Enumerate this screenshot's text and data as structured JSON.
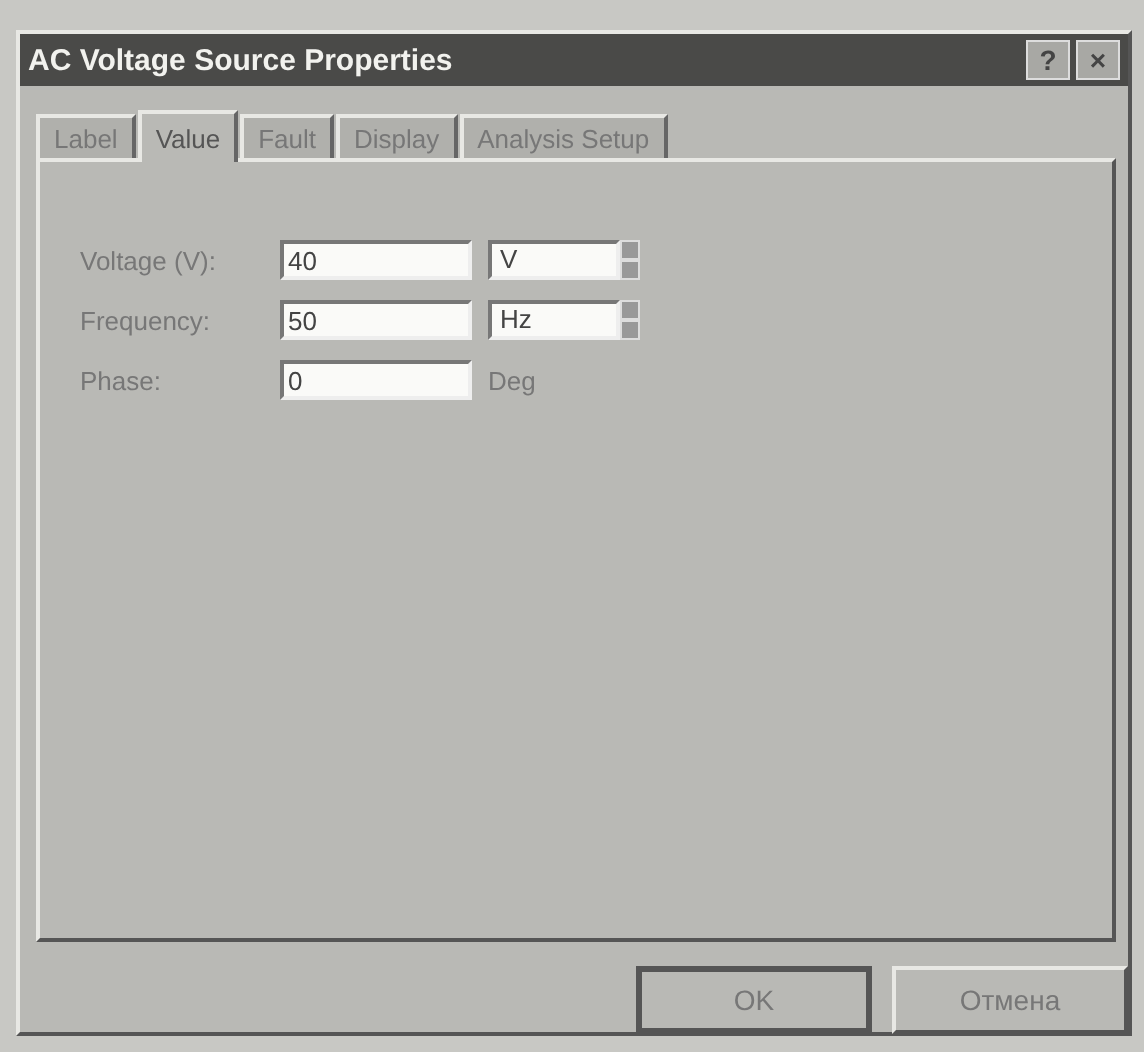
{
  "window": {
    "title": "AC Voltage Source Properties",
    "help_button": "?",
    "close_button": "×"
  },
  "tabs": [
    {
      "label": "Label",
      "selected": false
    },
    {
      "label": "Value",
      "selected": true
    },
    {
      "label": "Fault",
      "selected": false
    },
    {
      "label": "Display",
      "selected": false
    },
    {
      "label": "Analysis Setup",
      "selected": false
    }
  ],
  "fields": [
    {
      "label": "Voltage (V):",
      "value": "40",
      "kind": "spinner",
      "unit": "V"
    },
    {
      "label": "Frequency:",
      "value": "50",
      "kind": "spinner",
      "unit": "Hz"
    },
    {
      "label": "Phase:",
      "value": "0",
      "kind": "text",
      "unit": "Deg"
    }
  ],
  "buttons": [
    "OK",
    "Отмена"
  ]
}
